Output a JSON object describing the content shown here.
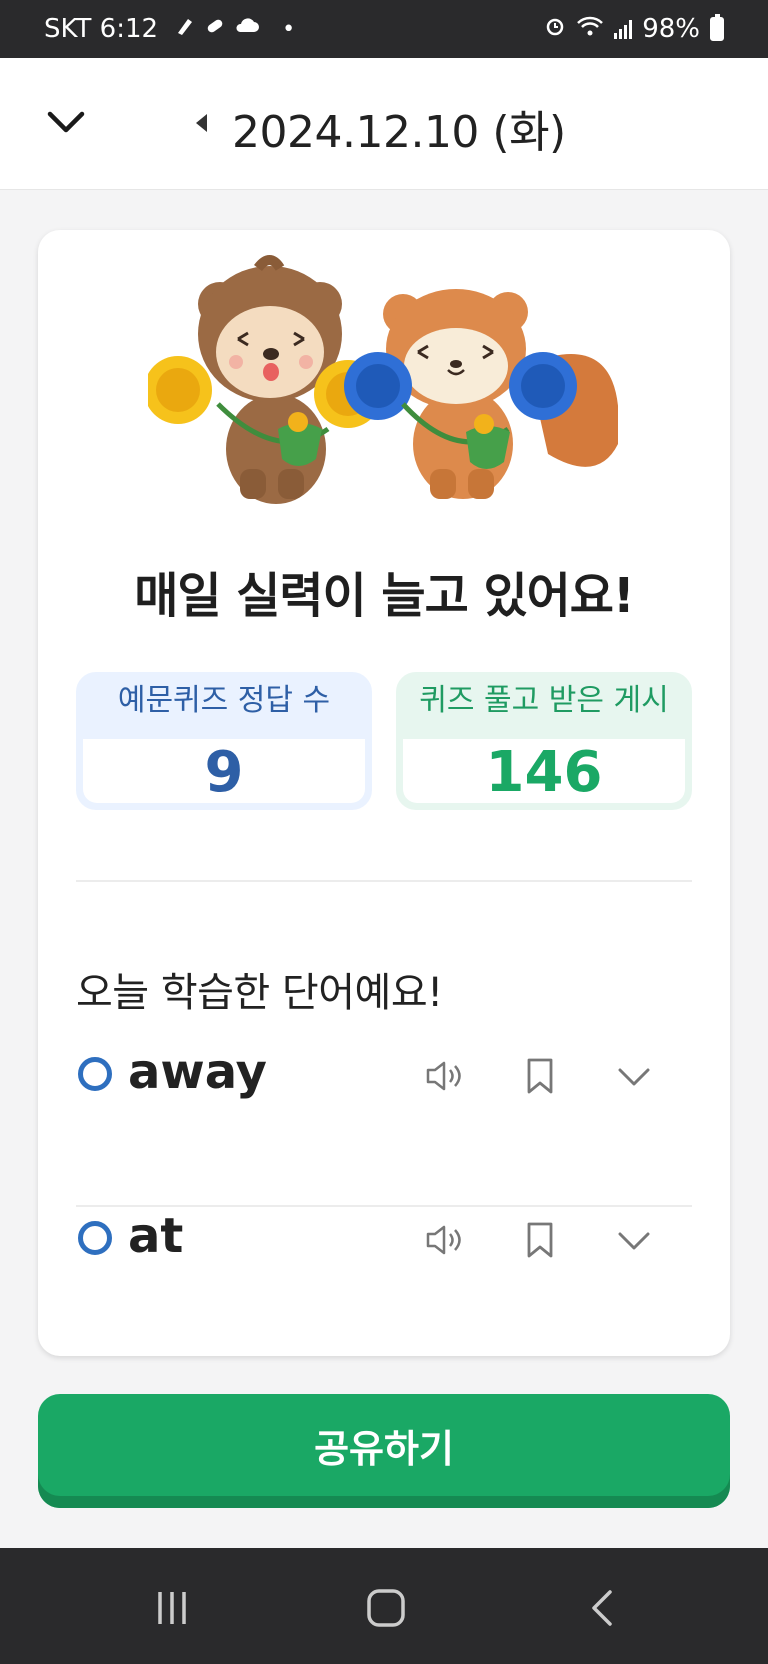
{
  "status_bar": {
    "carrier_time": "SKT 6:12",
    "dot": "•",
    "battery_percent": "98%",
    "icons": [
      "pen-icon",
      "pill-icon",
      "cloud-icon",
      "alarm-icon",
      "wifi-icon",
      "signal-icon",
      "battery-icon"
    ]
  },
  "header": {
    "date": "2024.12.10 (화)",
    "close_icon": "chevron-down-icon",
    "prev_icon": "triangle-left-icon"
  },
  "card": {
    "headline": "매일 실력이 늘고 있어요!",
    "stats": [
      {
        "label": "예문퀴즈 정답 수",
        "value": "9",
        "color": "#2e5fa6"
      },
      {
        "label": "퀴즈 풀고 받은 게시",
        "value": "146",
        "color": "#1aa865"
      }
    ],
    "section_title": "오늘 학습한 단어예요!",
    "words": [
      {
        "word": "away"
      },
      {
        "word": "at"
      }
    ]
  },
  "share_button": {
    "label": "공유하기",
    "color": "#1aa865"
  },
  "nav": {
    "icons": [
      "recent-apps-icon",
      "home-icon",
      "back-icon"
    ]
  }
}
